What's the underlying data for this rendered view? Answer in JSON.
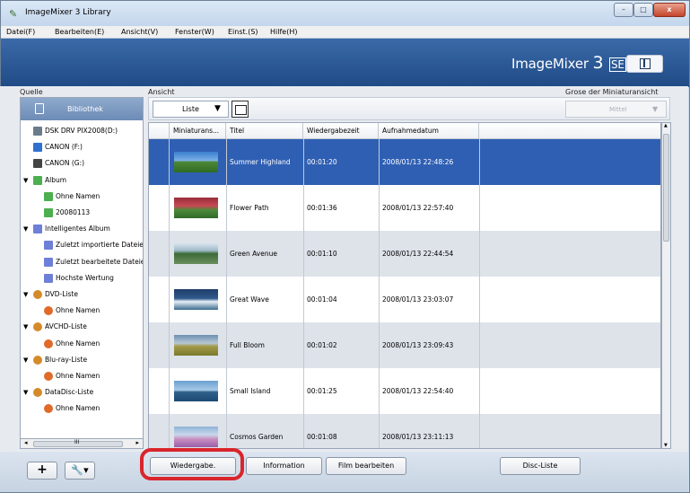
{
  "window": {
    "title": "ImageMixer 3 Library",
    "controls": [
      "–",
      "□",
      "x"
    ]
  },
  "menu": [
    "Datei(F)",
    "Bearbeiten(E)",
    "Ansicht(V)",
    "Fenster(W)",
    "Einst.(S)",
    "Hilfe(H)"
  ],
  "brand": {
    "name": "ImageMixer",
    "version": "3",
    "edition": "SE"
  },
  "sidebar": {
    "heading": "Quelle",
    "library_tab": "Bibliothek",
    "items": [
      {
        "label": "DSK DRV PIX2008(D:)",
        "level": 0,
        "icon": "drive-icon"
      },
      {
        "label": "CANON (F:)",
        "level": 0,
        "icon": "camera-icon"
      },
      {
        "label": "CANON (G:)",
        "level": 0,
        "icon": "camcorder-icon"
      },
      {
        "label": "Album",
        "level": 0,
        "icon": "album-icon",
        "expanded": true
      },
      {
        "label": "Ohne Namen",
        "level": 1,
        "icon": "album-icon"
      },
      {
        "label": "20080113",
        "level": 1,
        "icon": "album-icon"
      },
      {
        "label": "Intelligentes Album",
        "level": 0,
        "icon": "smart-album-icon",
        "expanded": true
      },
      {
        "label": "Zuletzt importierte Dateien",
        "level": 1,
        "icon": "smart-album-icon"
      },
      {
        "label": "Zuletzt bearbeitete Dateien",
        "level": 1,
        "icon": "smart-album-icon"
      },
      {
        "label": "Hochste Wertung",
        "level": 1,
        "icon": "smart-album-icon"
      },
      {
        "label": "DVD-Liste",
        "level": 0,
        "icon": "disc-icon",
        "expanded": true
      },
      {
        "label": "Ohne Namen",
        "level": 1,
        "icon": "disc-item-icon"
      },
      {
        "label": "AVCHD-Liste",
        "level": 0,
        "icon": "disc-icon",
        "expanded": true
      },
      {
        "label": "Ohne Namen",
        "level": 1,
        "icon": "disc-item-icon"
      },
      {
        "label": "Blu-ray-Liste",
        "level": 0,
        "icon": "disc-icon",
        "expanded": true
      },
      {
        "label": "Ohne Namen",
        "level": 1,
        "icon": "disc-item-icon"
      },
      {
        "label": "DataDisc-Liste",
        "level": 0,
        "icon": "disc-icon",
        "expanded": true
      },
      {
        "label": "Ohne Namen",
        "level": 1,
        "icon": "disc-item-icon"
      }
    ],
    "scrollbar": {
      "left_arrow": "◂",
      "grip": "III",
      "right_arrow": "▸"
    }
  },
  "view": {
    "heading": "Ansicht",
    "mode": "Liste",
    "thumb_size_heading": "Grose der Miniaturansicht",
    "thumb_size": "Mittel"
  },
  "table": {
    "columns": [
      "Miniaturans...",
      "Titel",
      "Wiedergabezeit",
      "Aufnahmedatum"
    ],
    "rows": [
      {
        "title": "Summer Highland",
        "duration": "00:01:20",
        "date": "2008/01/13 22:48:26",
        "selected": true
      },
      {
        "title": "Flower Path",
        "duration": "00:01:36",
        "date": "2008/01/13 22:57:40",
        "selected": false
      },
      {
        "title": "Green Avenue",
        "duration": "00:01:10",
        "date": "2008/01/13 22:44:54",
        "selected": false
      },
      {
        "title": "Great Wave",
        "duration": "00:01:04",
        "date": "2008/01/13 23:03:07",
        "selected": false
      },
      {
        "title": "Full Bloom",
        "duration": "00:01:02",
        "date": "2008/01/13 23:09:43",
        "selected": false
      },
      {
        "title": "Small Island",
        "duration": "00:01:25",
        "date": "2008/01/13 22:54:40",
        "selected": false
      },
      {
        "title": "Cosmos Garden",
        "duration": "00:01:08",
        "date": "2008/01/13 23:11:13",
        "selected": false
      }
    ]
  },
  "toolbar": {
    "add_label": "+",
    "tools_label": "🔧▾",
    "play_label": "Wiedergabe.",
    "info_label": "Information",
    "edit_label": "Film bearbeiten",
    "disc_label": "Disc-Liste"
  },
  "colors": {
    "accent": "#2f5fb3",
    "banner": "#2a5896",
    "highlight": "#d9252b",
    "row_alt": "#dee3ea"
  }
}
